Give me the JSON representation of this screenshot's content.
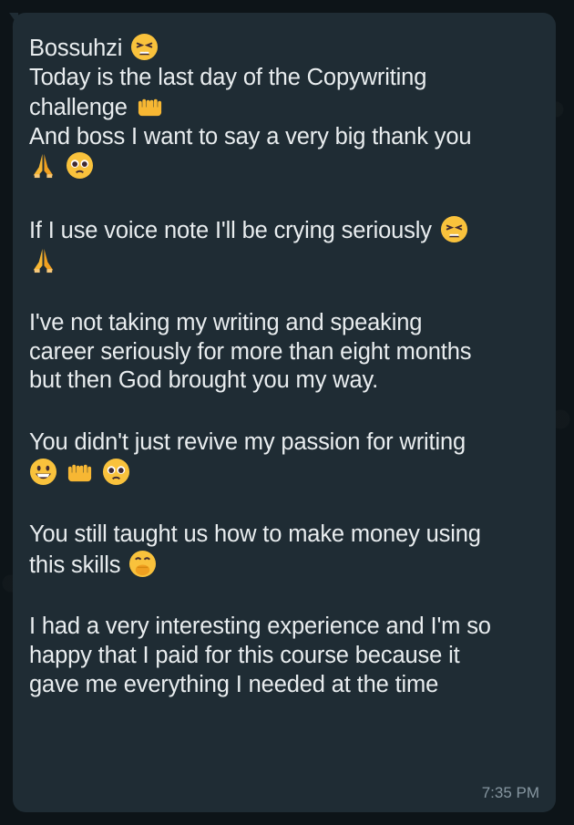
{
  "message": {
    "lines": [
      "Bossuhzi",
      "Today is the last day of the Copywriting",
      "challenge",
      "And boss I want to say a very big thank you",
      "",
      "If I use voice note I'll be crying seriously",
      "",
      "I've not taking my writing and speaking",
      "career seriously for more than eight months",
      "but then God brought you my way.",
      "You didn't just revive my passion for writing",
      "You still taught us how to make money using",
      "this skills",
      "I had a very interesting experience and I'm so",
      "happy that I paid for this course because it",
      "gave me everything I needed at the time"
    ],
    "emoji_names": [
      "tired-face-emoji",
      "raising-hands-emoji",
      "folded-hands-emoji",
      "pleading-face-emoji",
      "grinning-face-emoji",
      "hand-over-mouth-emoji"
    ],
    "timestamp": "7:35 PM"
  },
  "colors": {
    "bubble_bg": "#1f2c34",
    "text": "#e9edef",
    "timestamp": "#8696a0",
    "background": "#0b141a"
  }
}
